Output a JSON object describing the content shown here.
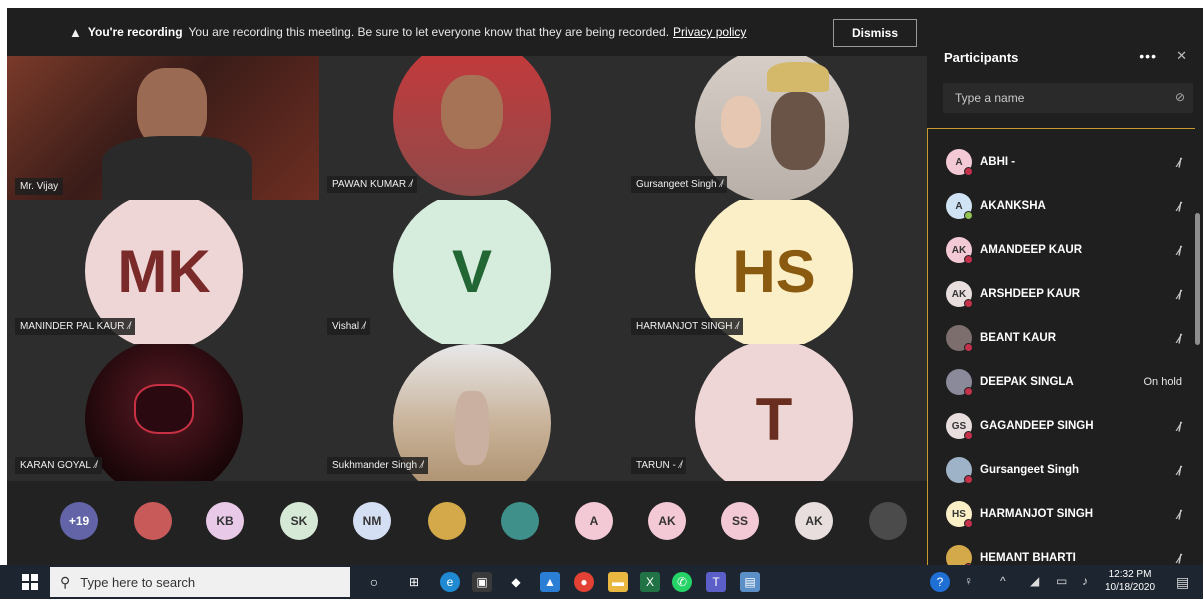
{
  "banner": {
    "bold": "You're recording",
    "text": "You are recording this meeting. Be sure to let everyone know that they are being recorded.",
    "link": "Privacy policy",
    "dismiss": "Dismiss"
  },
  "tiles": [
    {
      "name": "Mr. Vijay",
      "type": "video"
    },
    {
      "name": "PAWAN KUMAR",
      "type": "photo"
    },
    {
      "name": "Gursangeet Singh",
      "type": "photo"
    },
    {
      "name": "MANINDER PAL KAUR",
      "initials": "MK",
      "type": "initials"
    },
    {
      "name": "Vishal",
      "initials": "V",
      "type": "initials"
    },
    {
      "name": "HARMANJOT SINGH",
      "initials": "HS",
      "type": "initials"
    },
    {
      "name": "KARAN GOYAL",
      "type": "photo"
    },
    {
      "name": "Sukhmander Singh",
      "type": "photo"
    },
    {
      "name": "TARUN -",
      "initials": "T",
      "type": "initials"
    }
  ],
  "strip": [
    {
      "label": "+19",
      "color": "#6264a7"
    },
    {
      "label": "",
      "color": "#c85a5a"
    },
    {
      "label": "KB",
      "color": "#e9c9e8"
    },
    {
      "label": "SK",
      "color": "#d6e9d6"
    },
    {
      "label": "NM",
      "color": "#d5dff3"
    },
    {
      "label": "",
      "color": "#d4a94a"
    },
    {
      "label": "",
      "color": "#3f8f8a"
    },
    {
      "label": "A",
      "color": "#f4c9d6"
    },
    {
      "label": "AK",
      "color": "#f4c9d6"
    },
    {
      "label": "SS",
      "color": "#f4c9d6"
    },
    {
      "label": "AK",
      "color": "#e8dede"
    },
    {
      "label": "",
      "color": "#4b4b4b"
    }
  ],
  "panel": {
    "title": "Participants",
    "more": "•••",
    "close": "✕",
    "search_placeholder": "Type a name",
    "participants": [
      {
        "initials": "A",
        "name": "ABHI -",
        "color": "#f4c9d6",
        "status": "#c4314b",
        "right": "mic"
      },
      {
        "initials": "A",
        "name": "AKANKSHA",
        "color": "#cfe3f5",
        "status": "#92c353",
        "right": "mic"
      },
      {
        "initials": "AK",
        "name": "AMANDEEP KAUR",
        "color": "#f4c9d6",
        "status": "#c4314b",
        "right": "mic"
      },
      {
        "initials": "AK",
        "name": "ARSHDEEP KAUR",
        "color": "#e8dede",
        "status": "#c4314b",
        "right": "mic"
      },
      {
        "initials": "",
        "name": "BEANT KAUR",
        "color": "#7d6e6e",
        "status": "#c4314b",
        "right": "mic"
      },
      {
        "initials": "",
        "name": "DEEPAK SINGLA",
        "color": "#8a8a9a",
        "status": "#c4314b",
        "right": "On hold"
      },
      {
        "initials": "GS",
        "name": "GAGANDEEP SINGH",
        "color": "#e8dede",
        "status": "#c4314b",
        "right": "mic"
      },
      {
        "initials": "",
        "name": "Gursangeet Singh",
        "color": "#9eb3c8",
        "status": "#c4314b",
        "right": "mic"
      },
      {
        "initials": "HS",
        "name": "HARMANJOT SINGH",
        "color": "#fbefc7",
        "status": "#c4314b",
        "right": "mic"
      },
      {
        "initials": "",
        "name": "HEMANT BHARTI",
        "color": "#d4a94a",
        "status": "#c4314b",
        "right": "mic"
      }
    ]
  },
  "taskbar": {
    "search_placeholder": "Type here to search",
    "time": "12:32 PM",
    "date": "10/18/2020"
  }
}
